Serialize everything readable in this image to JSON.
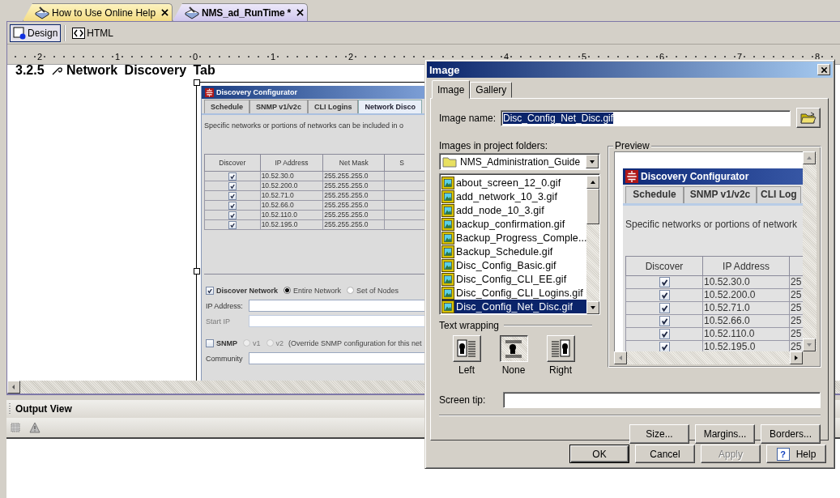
{
  "editor_tabs": [
    {
      "label": "How to Use Online Help",
      "selected": false
    },
    {
      "label": "NMS_ad_RunTime *",
      "selected": true
    }
  ],
  "view_buttons": [
    {
      "label": "Design",
      "kind": "design",
      "selected": true
    },
    {
      "label": "HTML",
      "kind": "html",
      "selected": false
    }
  ],
  "ruler_labels": [
    "2",
    "1",
    "0",
    "1",
    "2",
    "4",
    "5",
    "6",
    "7",
    "8"
  ],
  "document": {
    "heading_number": "3.2.5",
    "heading_title": "Network Discovery Tab",
    "screenshot": {
      "title": "Discovery Configurator",
      "tabs": [
        {
          "label": "Schedule",
          "selected": false
        },
        {
          "label": "SNMP v1/v2c",
          "selected": false
        },
        {
          "label": "CLI Logins",
          "selected": false
        },
        {
          "label": "Network Disco",
          "selected": true
        }
      ],
      "description": "Specific networks or portions of networks can be included in o",
      "columns": [
        "Discover",
        "IP Address",
        "Net Mask",
        "S"
      ],
      "rows": [
        {
          "checked": true,
          "ip": "10.52.30.0",
          "mask": "255.255.255.0"
        },
        {
          "checked": true,
          "ip": "10.52.200.0",
          "mask": "255.255.255.0"
        },
        {
          "checked": true,
          "ip": "10.52.71.0",
          "mask": "255.255.255.0"
        },
        {
          "checked": true,
          "ip": "10.52.66.0",
          "mask": "255.255.255.0"
        },
        {
          "checked": true,
          "ip": "10.52.110.0",
          "mask": "255.255.255.0"
        },
        {
          "checked": true,
          "ip": "10.52.195.0",
          "mask": "255.255.255.0"
        }
      ],
      "discover_network": {
        "label": "Discover Network",
        "checked": true
      },
      "scope_options": [
        {
          "label": "Entire Network",
          "selected": true
        },
        {
          "label": "Set of Nodes",
          "selected": false
        }
      ],
      "fields": [
        {
          "label": "IP Address:",
          "disabled": false
        },
        {
          "label": "Start IP",
          "disabled": true
        }
      ],
      "snmp": {
        "label": "SNMP",
        "checked": false
      },
      "snmp_versions": [
        {
          "label": "v1",
          "selected": false,
          "disabled": true
        },
        {
          "label": "v2",
          "selected": false,
          "disabled": true
        }
      ],
      "snmp_note": "(Override SNMP configuration for this net",
      "community_label": "Community"
    }
  },
  "output_view": {
    "title": "Output View"
  },
  "image_dialog": {
    "title": "Image",
    "tabs": [
      {
        "label": "Image",
        "selected": true
      },
      {
        "label": "Gallery",
        "selected": false
      }
    ],
    "image_name_label": "Image name:",
    "image_name": "Disc_Config_Net_Disc.gif",
    "folders_label": "Images in project folders:",
    "folder": "NMS_Administration_Guide",
    "files": [
      {
        "name": "about_screen_12_0.gif",
        "selected": false
      },
      {
        "name": "add_network_10_3.gif",
        "selected": false
      },
      {
        "name": "add_node_10_3.gif",
        "selected": false
      },
      {
        "name": "backup_confirmation.gif",
        "selected": false
      },
      {
        "name": "Backup_Progress_Comple...",
        "selected": false
      },
      {
        "name": "Backup_Schedule.gif",
        "selected": false
      },
      {
        "name": "Disc_Config_Basic.gif",
        "selected": false
      },
      {
        "name": "Disc_Config_CLI_EE.gif",
        "selected": false
      },
      {
        "name": "Disc_Config_CLI_Logins.gif",
        "selected": false
      },
      {
        "name": "Disc_Config_Net_Disc.gif",
        "selected": true
      }
    ],
    "text_wrapping_label": "Text wrapping",
    "wrap_options": [
      {
        "label": "Left",
        "kind": "left",
        "selected": false
      },
      {
        "label": "None",
        "kind": "none",
        "selected": true
      },
      {
        "label": "Right",
        "kind": "right",
        "selected": false
      }
    ],
    "preview_label": "Preview",
    "preview": {
      "title": "Discovery Configurator",
      "tabs": [
        {
          "label": "Schedule",
          "selected": false
        },
        {
          "label": "SNMP v1/v2c",
          "selected": false
        },
        {
          "label": "CLI Log",
          "selected": false
        }
      ],
      "description": "Specific networks or portions of network",
      "columns": [
        "Discover",
        "IP Address"
      ],
      "rows": [
        {
          "checked": true,
          "ip": "10.52.30.0",
          "column_3": "25"
        },
        {
          "checked": true,
          "ip": "10.52.200.0",
          "column_3": "25"
        },
        {
          "checked": true,
          "ip": "10.52.71.0",
          "column_3": "25"
        },
        {
          "checked": true,
          "ip": "10.52.66.0",
          "column_3": "25"
        },
        {
          "checked": true,
          "ip": "10.52.110.0",
          "column_3": "25"
        },
        {
          "checked": true,
          "ip": "10.52.195.0",
          "column_3": "25"
        }
      ]
    },
    "screen_tip_label": "Screen tip:",
    "format_buttons": [
      "Size...",
      "Margins...",
      "Borders..."
    ],
    "buttons": [
      {
        "label": "OK",
        "kind": "plain",
        "default": true,
        "disabled": false
      },
      {
        "label": "Cancel",
        "kind": "plain",
        "default": false,
        "disabled": false
      },
      {
        "label": "Apply",
        "kind": "plain",
        "default": false,
        "disabled": true
      },
      {
        "label": "Help",
        "kind": "help",
        "icon": "?",
        "default": false,
        "disabled": false
      }
    ]
  }
}
